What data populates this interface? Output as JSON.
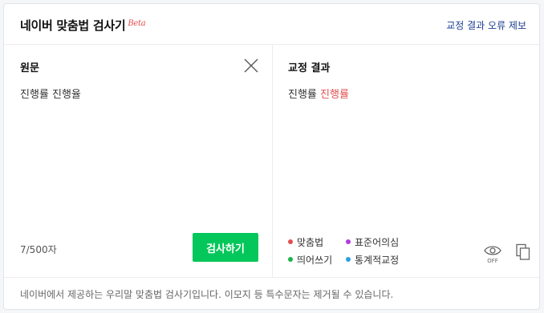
{
  "header": {
    "title": "네이버 맞춤법 검사기",
    "beta": "Beta",
    "report_link": "교정 결과 오류 제보"
  },
  "source": {
    "title": "원문",
    "text": "진행률 진행율",
    "char_count": "7/500자",
    "check_button": "검사하기",
    "close_icon": "close-icon"
  },
  "result": {
    "title": "교정 결과",
    "correct_word": "진행률",
    "corrected_word": "진행률",
    "legend": [
      {
        "label": "맞춤법",
        "color": "#e34f4f"
      },
      {
        "label": "표준어의심",
        "color": "#b23be0"
      },
      {
        "label": "띄어쓰기",
        "color": "#1cb34a"
      },
      {
        "label": "통계적교정",
        "color": "#2d9fe0"
      }
    ],
    "eye_toggle_label": "OFF"
  },
  "footer": {
    "notice": "네이버에서 제공하는 우리말 맞춤법 검사기입니다. 이모지 등 특수문자는 제거될 수 있습니다."
  },
  "colors": {
    "accent_green": "#03c75a",
    "error_red": "#e34f4f",
    "link_blue": "#1a3c8f"
  }
}
